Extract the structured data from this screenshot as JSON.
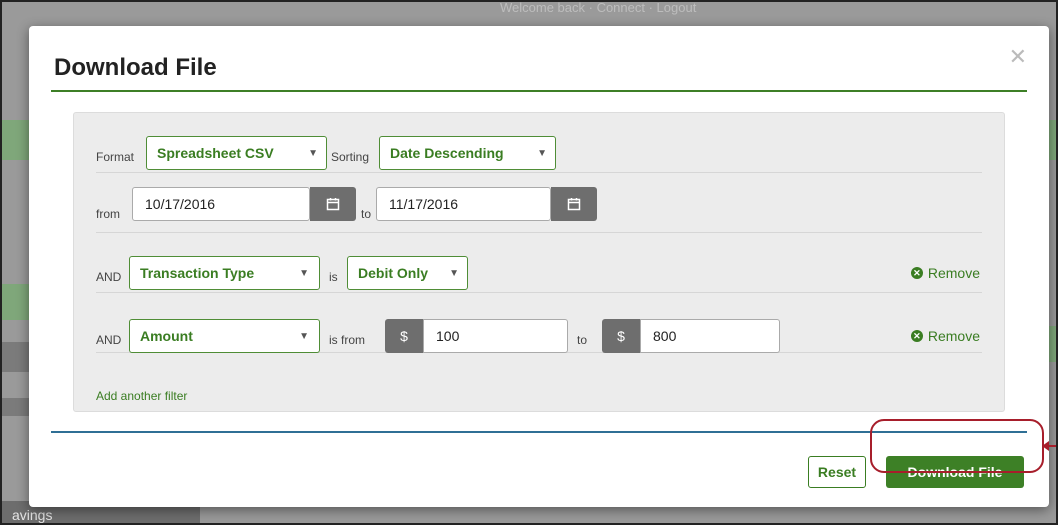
{
  "background": {
    "top_text": "Welcome back · Connect · Logout",
    "footer_tab": "avings"
  },
  "modal": {
    "title": "Download File",
    "close_icon": "close-icon"
  },
  "format_row": {
    "format_label": "Format",
    "format_value": "Spreadsheet CSV",
    "sorting_label": "Sorting",
    "sorting_value": "Date Descending"
  },
  "date_row": {
    "from_label": "from",
    "from_value": "10/17/2016",
    "to_label": "to",
    "to_value": "11/17/2016",
    "calendar_icon": "calendar-icon"
  },
  "filters": [
    {
      "and_label": "AND",
      "field_value": "Transaction Type",
      "operator_label": "is",
      "value": "Debit Only",
      "remove_label": "Remove"
    },
    {
      "and_label": "AND",
      "field_value": "Amount",
      "operator_label": "is from",
      "currency_symbol": "$",
      "from_value": "100",
      "to_label": "to",
      "to_value": "800",
      "remove_label": "Remove"
    }
  ],
  "add_filter_label": "Add another filter",
  "footer": {
    "reset_label": "Reset",
    "download_label": "Download File"
  },
  "colors": {
    "accent_green": "#3d8026",
    "divider_blue": "#2f6f95",
    "highlight_red": "#a71e2b"
  }
}
